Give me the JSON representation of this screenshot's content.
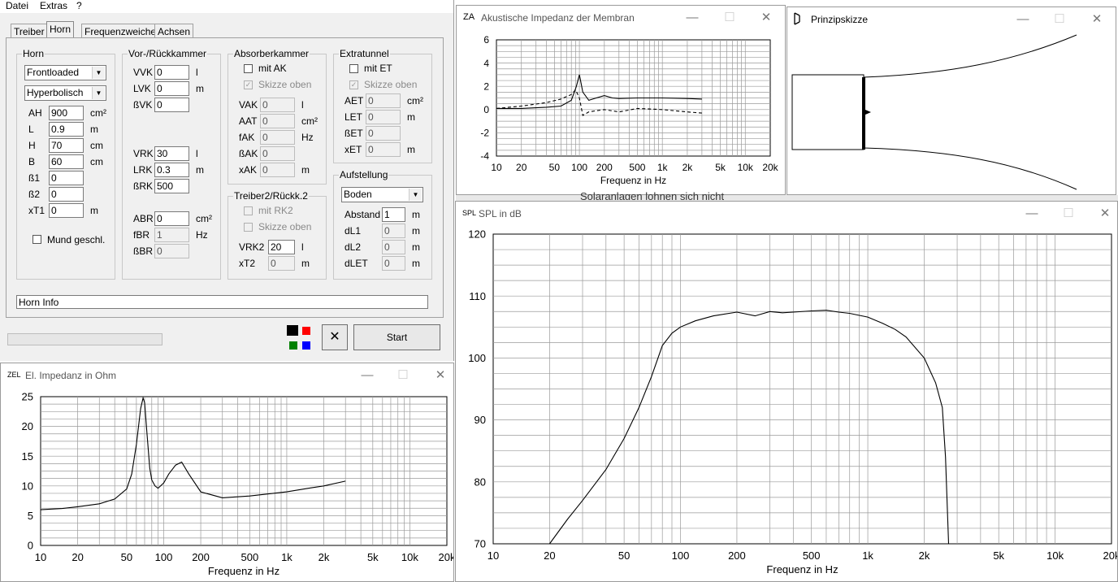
{
  "menu": {
    "items": [
      "Datei",
      "Extras",
      "?"
    ]
  },
  "tabs": [
    "Treiber",
    "Horn",
    "Frequenzweiche",
    "Achsen"
  ],
  "horn": {
    "title": "Horn",
    "load_select": "Frontloaded",
    "profile_select": "Hyperbolisch",
    "fields": [
      {
        "label": "AH",
        "value": "900",
        "unit": "cm²"
      },
      {
        "label": "L",
        "value": "0.9",
        "unit": "m"
      },
      {
        "label": "H",
        "value": "70",
        "unit": "cm"
      },
      {
        "label": "B",
        "value": "60",
        "unit": "cm"
      },
      {
        "label": "ß1",
        "value": "0",
        "unit": ""
      },
      {
        "label": "ß2",
        "value": "0",
        "unit": ""
      },
      {
        "label": "xT1",
        "value": "0",
        "unit": "m"
      }
    ],
    "mouth_closed_label": "Mund geschl."
  },
  "chamber": {
    "title": "Vor-/Rückkammer",
    "front": [
      {
        "label": "VVK",
        "value": "0",
        "unit": "l"
      },
      {
        "label": "LVK",
        "value": "0",
        "unit": "m"
      },
      {
        "label": "ßVK",
        "value": "0",
        "unit": ""
      }
    ],
    "rear": [
      {
        "label": "VRK",
        "value": "30",
        "unit": "l"
      },
      {
        "label": "LRK",
        "value": "0.3",
        "unit": "m"
      },
      {
        "label": "ßRK",
        "value": "500",
        "unit": ""
      }
    ],
    "port": [
      {
        "label": "ABR",
        "value": "0",
        "unit": "cm²"
      },
      {
        "label": "fBR",
        "value": "1",
        "unit": "Hz"
      },
      {
        "label": "ßBR",
        "value": "0",
        "unit": ""
      }
    ]
  },
  "absorber": {
    "title": "Absorberkammer",
    "check_label": "mit AK",
    "sketch_label": "Skizze oben",
    "fields": [
      {
        "label": "VAK",
        "value": "0",
        "unit": "l"
      },
      {
        "label": "AAT",
        "value": "0",
        "unit": "cm²"
      },
      {
        "label": "fAK",
        "value": "0",
        "unit": "Hz"
      },
      {
        "label": "ßAK",
        "value": "0",
        "unit": ""
      },
      {
        "label": "xAK",
        "value": "0",
        "unit": "m"
      }
    ]
  },
  "driver2": {
    "title": "Treiber2/Rückk.2",
    "check_label": "mit RK2",
    "sketch_label": "Skizze oben",
    "fields": [
      {
        "label": "VRK2",
        "value": "20",
        "unit": "l"
      },
      {
        "label": "xT2",
        "value": "0",
        "unit": "m"
      }
    ]
  },
  "extratunnel": {
    "title": "Extratunnel",
    "check_label": "mit ET",
    "sketch_label": "Skizze oben",
    "fields": [
      {
        "label": "AET",
        "value": "0",
        "unit": "cm²"
      },
      {
        "label": "LET",
        "value": "0",
        "unit": "m"
      },
      {
        "label": "ßET",
        "value": "0",
        "unit": ""
      },
      {
        "label": "xET",
        "value": "0",
        "unit": "m"
      }
    ]
  },
  "placement": {
    "title": "Aufstellung",
    "select": "Boden",
    "fields": [
      {
        "label": "Abstand",
        "value": "1",
        "unit": "m"
      },
      {
        "label": "dL1",
        "value": "0",
        "unit": "m"
      },
      {
        "label": "dL2",
        "value": "0",
        "unit": "m"
      },
      {
        "label": "dLET",
        "value": "0",
        "unit": "m"
      }
    ]
  },
  "info_text": "Horn Info",
  "start_label": "Start",
  "colors": {
    "swatch1": "#000000",
    "swatch2": "#ff0000",
    "swatch3": "#008000",
    "swatch4": "#0000ff",
    "panel_bg": "#f0f0f0"
  },
  "windows": {
    "za": {
      "icon": "ZA",
      "title": "Akustische Impedanz der Membran"
    },
    "sketch": {
      "title": "Prinzipskizze"
    },
    "spl": {
      "icon": "SPL",
      "title": "SPL in dB"
    },
    "zel": {
      "icon": "ZEL",
      "title": "El. Impedanz in Ohm"
    }
  },
  "background_text": "Solaranlagen lohnen sich nicht",
  "chart_data": [
    {
      "id": "za",
      "type": "line",
      "xlabel": "Frequenz in Hz",
      "xscale": "log",
      "xlim": [
        10,
        20000
      ],
      "ylim": [
        -4,
        6
      ],
      "yticks": [
        -4,
        -2,
        0,
        2,
        4,
        6
      ],
      "xticklabels": [
        "10",
        "20",
        "50",
        "100",
        "200",
        "500",
        "1k",
        "2k",
        "5k",
        "10k",
        "20k"
      ],
      "grid": true,
      "series": [
        {
          "style": "solid",
          "x": [
            10,
            20,
            40,
            60,
            80,
            92,
            100,
            110,
            130,
            160,
            200,
            250,
            300,
            500,
            1000,
            2000,
            3000
          ],
          "y": [
            0.1,
            0.1,
            0.2,
            0.3,
            0.8,
            2.0,
            3.0,
            1.5,
            0.8,
            1.0,
            1.2,
            1.0,
            0.95,
            1.0,
            1.0,
            0.95,
            0.9
          ]
        },
        {
          "style": "dashed",
          "x": [
            10,
            20,
            40,
            60,
            80,
            90,
            100,
            110,
            130,
            160,
            200,
            300,
            500,
            1000,
            2000,
            3000
          ],
          "y": [
            0.1,
            0.3,
            0.6,
            0.9,
            1.3,
            1.7,
            1.0,
            -0.5,
            -0.2,
            -0.1,
            0.0,
            -0.2,
            0.1,
            0.0,
            -0.2,
            -0.3
          ]
        }
      ]
    },
    {
      "id": "spl",
      "type": "line",
      "xlabel": "Frequenz in Hz",
      "xscale": "log",
      "xlim": [
        10,
        20000
      ],
      "ylim": [
        70,
        120
      ],
      "yticks": [
        70,
        80,
        90,
        100,
        110,
        120
      ],
      "xticklabels": [
        "10",
        "20",
        "50",
        "100",
        "200",
        "500",
        "1k",
        "2k",
        "5k",
        "10k",
        "20k"
      ],
      "grid": true,
      "series": [
        {
          "style": "solid",
          "x": [
            20,
            25,
            30,
            40,
            50,
            60,
            70,
            80,
            90,
            100,
            120,
            150,
            200,
            250,
            300,
            350,
            400,
            500,
            600,
            700,
            800,
            1000,
            1200,
            1400,
            1600,
            2000,
            2300,
            2500,
            2600,
            2700
          ],
          "y": [
            70,
            74,
            77,
            82,
            87,
            92,
            97,
            102,
            104,
            105,
            106,
            106.8,
            107.4,
            106.8,
            107.5,
            107.3,
            107.4,
            107.6,
            107.7,
            107.4,
            107.2,
            106.6,
            105.6,
            104.6,
            103.4,
            100,
            96,
            92,
            84,
            70
          ]
        }
      ]
    },
    {
      "id": "zel",
      "type": "line",
      "xlabel": "Frequenz in Hz",
      "xscale": "log",
      "xlim": [
        10,
        20000
      ],
      "ylim": [
        0,
        25
      ],
      "yticks": [
        0,
        5,
        10,
        15,
        20,
        25
      ],
      "xticklabels": [
        "10",
        "20",
        "50",
        "100",
        "200",
        "500",
        "1k",
        "2k",
        "5k",
        "10k",
        "20k"
      ],
      "grid": true,
      "series": [
        {
          "style": "solid",
          "x": [
            10,
            15,
            20,
            30,
            40,
            50,
            55,
            60,
            65,
            68,
            70,
            73,
            77,
            80,
            85,
            90,
            100,
            110,
            125,
            140,
            160,
            200,
            300,
            500,
            1000,
            1500,
            2000,
            3000
          ],
          "y": [
            6,
            6.2,
            6.5,
            7,
            7.8,
            9.5,
            12,
            17,
            23,
            24.8,
            24,
            19,
            13,
            11,
            10,
            9.6,
            10.5,
            12,
            13.5,
            14,
            12,
            9,
            8,
            8.3,
            9,
            9.6,
            10,
            10.8
          ]
        }
      ]
    }
  ]
}
